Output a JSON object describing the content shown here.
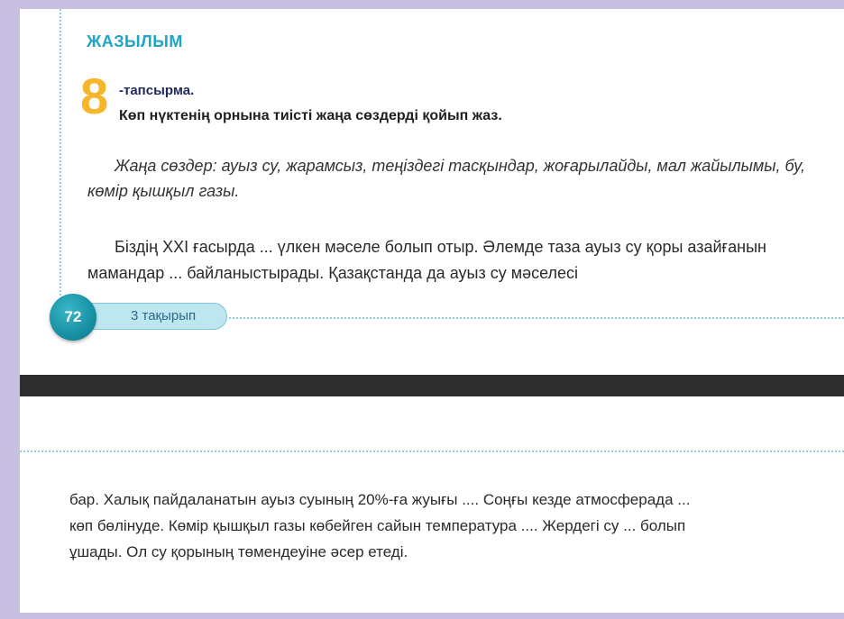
{
  "top_cut_text": "— — — — — — — — — — — — — —",
  "section_heading": "ЖАЗЫЛЫМ",
  "task": {
    "number": "8",
    "label": "-тапсырма.",
    "instruction": "Көп нүктенің орнына тиісті жаңа сөздерді қойып жаз."
  },
  "new_words": "Жаңа сөздер: ауыз су, жарамсыз, теңіздегі тасқындар, жоғарылайды, мал жайылымы, бу, көмір қышқыл газы.",
  "paragraph_top": "Біздің XXI ғасырда ... үлкен мәселе болып отыр. Әлемде таза ауыз су қоры азайғанын мамандар ... байланыстырады. Қазақстанда да ауыз су мәселесі",
  "page_footer": {
    "page_number": "72",
    "topic": "3 тақырып"
  },
  "paragraph_bottom": "бар. Халық пайдаланатын ауыз суының 20%-ға жуығы .... Соңғы кезде атмосферада ... көп бөлінуде. Көмір қышқыл газы көбейген сайын температура .... Жердегі су ... болып ұшады. Ол су қорының төмендеуіне әсер етеді.",
  "colors": {
    "background": "#c9bfe0",
    "heading": "#1da5c9",
    "task_number": "#f7b62a",
    "badge": "#14899e",
    "divider_bar": "#2d2d2d"
  }
}
